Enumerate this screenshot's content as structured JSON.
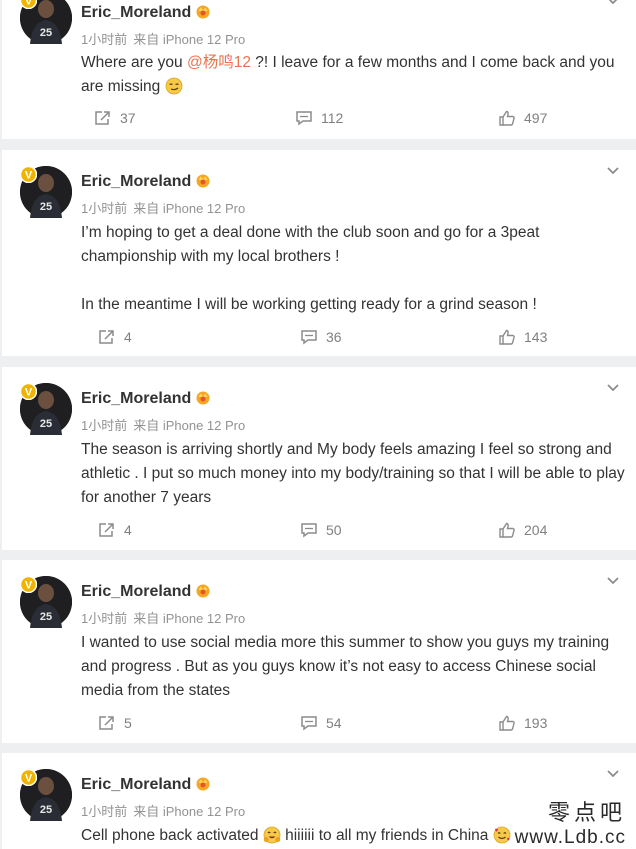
{
  "posts": [
    {
      "username": "Eric_Moreland",
      "time": "1小时前",
      "source": "来自 iPhone 12 Pro",
      "text_before_mention": "Where are you ",
      "mention": "@杨鸣12",
      "text_after_mention": " ?! I leave for a few months and I come back and you are missing ",
      "emoji": "smirk-face-emoji",
      "reposts": "37",
      "comments": "112",
      "likes": "497"
    },
    {
      "username": "Eric_Moreland",
      "time": "1小时前",
      "source": "来自 iPhone 12 Pro",
      "paragraph1": "I’m hoping to get a deal done with the club soon and go for a 3peat championship with my local brothers !",
      "paragraph2": "In the meantime I will be working getting ready for a grind season !",
      "reposts": "4",
      "comments": "36",
      "likes": "143"
    },
    {
      "username": "Eric_Moreland",
      "time": "1小时前",
      "source": "来自 iPhone 12 Pro",
      "text": "The season is arriving shortly and My body feels amazing I feel so strong and athletic . I put so much money into my body/training so that I will be able to play for another 7 years",
      "reposts": "4",
      "comments": "50",
      "likes": "204"
    },
    {
      "username": "Eric_Moreland",
      "time": "1小时前",
      "source": "来自 iPhone 12 Pro",
      "text": "I wanted to use social media more this summer to show you guys my training and progress . But as you guys know it’s not easy to access Chinese social media from the states",
      "reposts": "5",
      "comments": "54",
      "likes": "193"
    },
    {
      "username": "Eric_Moreland",
      "time": "1小时前",
      "source": "来自 iPhone 12 Pro",
      "text_part1": "Cell phone back activated ",
      "emoji1": "hugging-face-emoji",
      "text_part2": " hiiiiii to all my friends in China ",
      "emoji2": "smiling-face-with-hearts-emoji"
    }
  ],
  "watermark": {
    "site_name": "零点吧",
    "url": "www.Ldb.cc"
  },
  "colors": {
    "mention": "#eb7350",
    "username": "#333333",
    "meta": "#939393",
    "action": "#808080",
    "background": "#eeeff1",
    "verified": "#f0b400",
    "crown": "#f5a623"
  }
}
